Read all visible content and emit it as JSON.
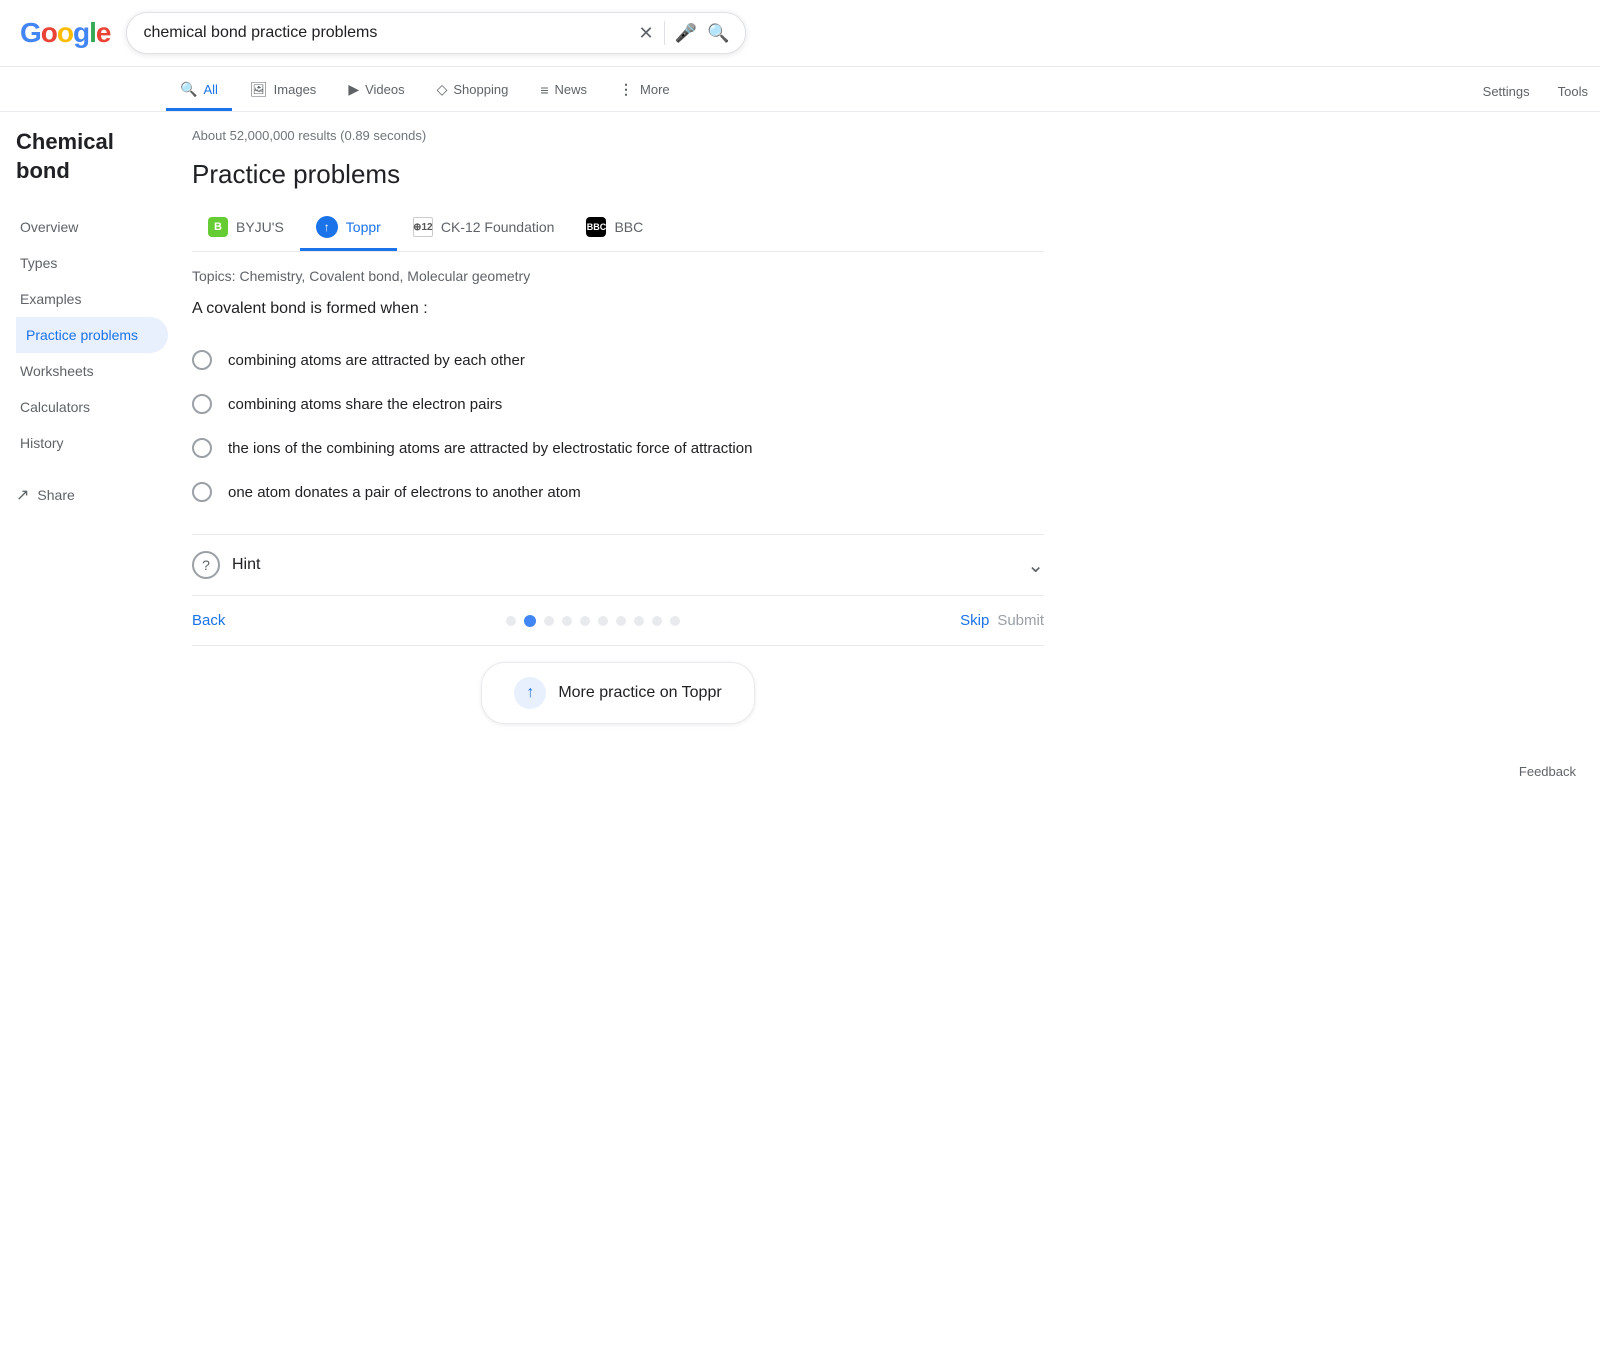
{
  "header": {
    "logo": {
      "g1": "G",
      "o1": "o",
      "o2": "o",
      "g2": "g",
      "l": "l",
      "e": "e"
    },
    "search_value": "chemical bond practice problems"
  },
  "nav": {
    "tabs": [
      {
        "id": "all",
        "label": "All",
        "icon": "🔍",
        "active": true
      },
      {
        "id": "images",
        "label": "Images",
        "icon": "🖼"
      },
      {
        "id": "videos",
        "label": "Videos",
        "icon": "▶"
      },
      {
        "id": "shopping",
        "label": "Shopping",
        "icon": "◇"
      },
      {
        "id": "news",
        "label": "News",
        "icon": "≡"
      },
      {
        "id": "more",
        "label": "More",
        "icon": "⋮"
      }
    ],
    "settings": "Settings",
    "tools": "Tools"
  },
  "results_info": "About 52,000,000 results (0.89 seconds)",
  "section_title": "Practice problems",
  "source_tabs": [
    {
      "id": "byjus",
      "label": "BYJU'S",
      "active": false
    },
    {
      "id": "toppr",
      "label": "Toppr",
      "active": true
    },
    {
      "id": "ck12",
      "label": "CK-12 Foundation",
      "active": false
    },
    {
      "id": "bbc",
      "label": "BBC",
      "active": false
    }
  ],
  "topics": "Topics: Chemistry, Covalent bond, Molecular geometry",
  "question": "A covalent bond is formed when :",
  "options": [
    {
      "id": "a",
      "text": "combining atoms are attracted by each other"
    },
    {
      "id": "b",
      "text": "combining atoms share the electron pairs"
    },
    {
      "id": "c",
      "text": "the ions of the combining atoms are attracted by electrostatic force of attraction"
    },
    {
      "id": "d",
      "text": "one atom donates a pair of electrons to another atom"
    }
  ],
  "hint": {
    "label": "Hint",
    "icon": "?"
  },
  "navigation": {
    "back": "Back",
    "skip": "Skip",
    "submit": "Submit",
    "dots_count": 10,
    "active_dot": 1
  },
  "more_practice": {
    "label": "More practice on Toppr",
    "icon_arrow": "↑"
  },
  "sidebar": {
    "title": "Chemical bond",
    "items": [
      {
        "id": "overview",
        "label": "Overview"
      },
      {
        "id": "types",
        "label": "Types"
      },
      {
        "id": "examples",
        "label": "Examples"
      },
      {
        "id": "practice-problems",
        "label": "Practice problems",
        "active": true
      },
      {
        "id": "worksheets",
        "label": "Worksheets"
      },
      {
        "id": "calculators",
        "label": "Calculators"
      },
      {
        "id": "history",
        "label": "History"
      }
    ],
    "share": "Share"
  },
  "feedback": {
    "label": "Feedback"
  }
}
